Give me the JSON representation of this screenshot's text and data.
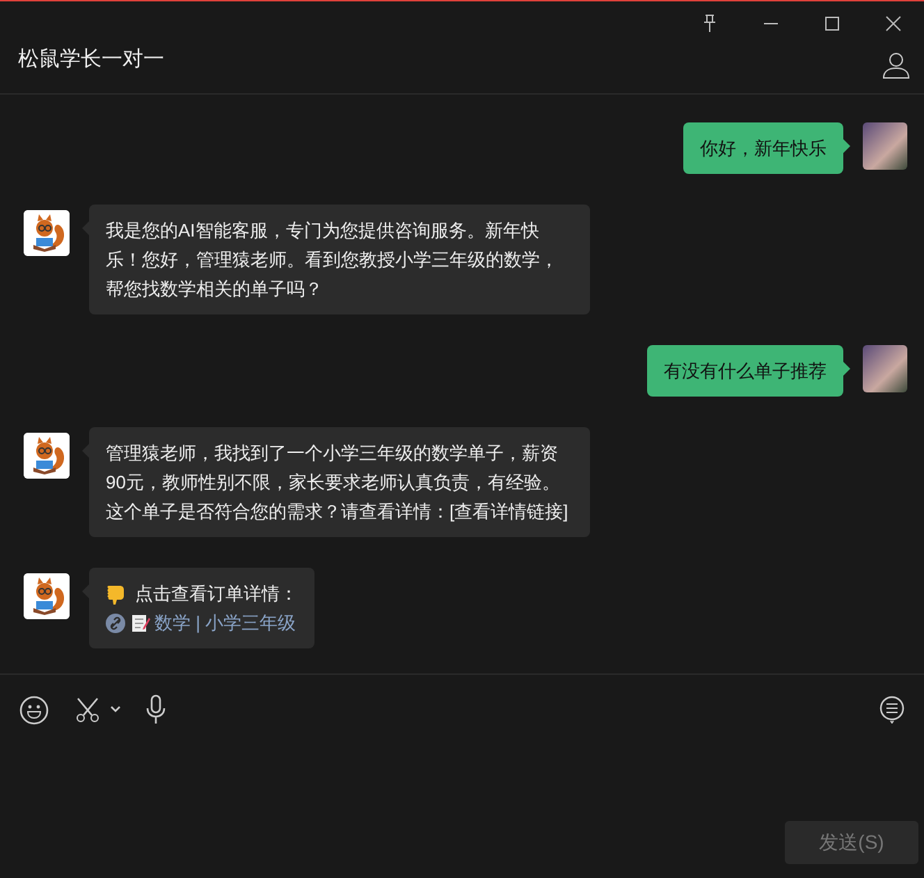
{
  "window": {
    "title": "松鼠学长一对一"
  },
  "messages": [
    {
      "kind": "outgoing",
      "text": "你好，新年快乐"
    },
    {
      "kind": "incoming",
      "text": "我是您的AI智能客服，专门为您提供咨询服务。新年快乐！您好，管理猿老师。看到您教授小学三年级的数学，帮您找数学相关的单子吗？"
    },
    {
      "kind": "outgoing",
      "text": "有没有什么单子推荐"
    },
    {
      "kind": "incoming",
      "text": "管理猿老师，我找到了一个小学三年级的数学单子，薪资90元，教师性别不限，家长要求老师认真负责，有经验。这个单子是否符合您的需求？请查看详情：[查看详情链接]"
    },
    {
      "kind": "card",
      "text": "点击查看订单详情：",
      "link": "数学 | 小学三年级"
    }
  ],
  "send_button": {
    "label": "发送(S)",
    "disabled": true
  }
}
